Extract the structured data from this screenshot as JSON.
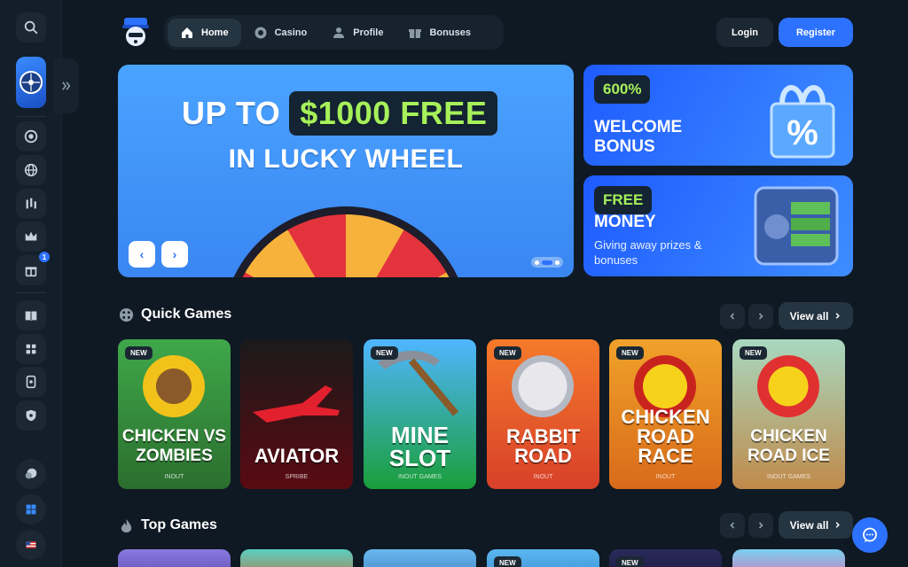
{
  "nav": {
    "items": [
      {
        "label": "Home",
        "icon": "home-icon",
        "active": true
      },
      {
        "label": "Casino",
        "icon": "chip-icon",
        "active": false
      },
      {
        "label": "Profile",
        "icon": "user-icon",
        "active": false
      },
      {
        "label": "Bonuses",
        "icon": "gift-icon",
        "active": false
      }
    ]
  },
  "auth": {
    "login": "Login",
    "register": "Register"
  },
  "sidebar": {
    "gift_badge": "1"
  },
  "hero": {
    "line1_prefix": "UP TO",
    "line1_highlight": "$1000 FREE",
    "line2": "IN LUCKY WHEEL",
    "prev": "‹",
    "next": "›"
  },
  "promos": [
    {
      "tag": "600%",
      "title": "WELCOME BONUS",
      "subtitle": ""
    },
    {
      "tag": "FREE",
      "title": "MONEY",
      "subtitle": "Giving away prizes & bonuses"
    }
  ],
  "quick_games": {
    "title": "Quick Games",
    "view_all": "View all",
    "games": [
      {
        "badge": "NEW",
        "title": "CHICKEN VS ZOMBIES",
        "provider": "INOUT"
      },
      {
        "badge": "",
        "title": "AVIATOR",
        "provider": "SPRIBE"
      },
      {
        "badge": "NEW",
        "title": "MINE SLOT",
        "provider": "INOUT GAMES"
      },
      {
        "badge": "NEW",
        "title": "RABBIT ROAD",
        "provider": "INOUT"
      },
      {
        "badge": "NEW",
        "title": "CHICKEN ROAD RACE",
        "provider": "INOUT"
      },
      {
        "badge": "NEW",
        "title": "CHICKEN ROAD ICE",
        "provider": "INOUT GAMES"
      }
    ]
  },
  "top_games": {
    "title": "Top Games",
    "view_all": "View all",
    "badges": [
      "",
      "",
      "",
      "NEW",
      "NEW",
      ""
    ]
  },
  "colors": {
    "accent": "#2d72ff",
    "highlight": "#a6f05a",
    "bg": "#0f1923"
  }
}
